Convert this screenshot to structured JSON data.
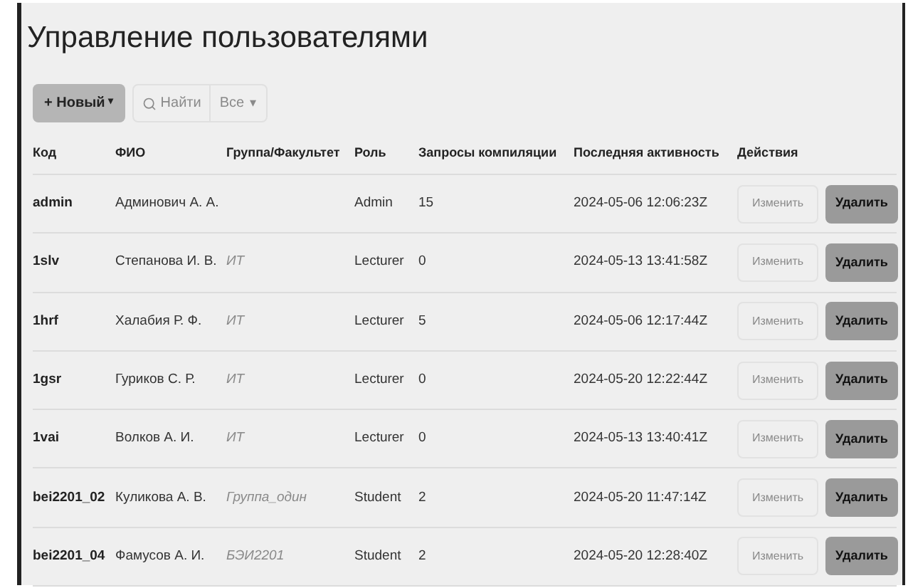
{
  "title": "Управление пользователями",
  "toolbar": {
    "new_button": "+ Новый",
    "new_caret": "▾",
    "search": {
      "label": "Найти",
      "disabled": true
    },
    "filter": {
      "value": "Все",
      "caret": "▾",
      "disabled": true
    }
  },
  "table": {
    "columns": [
      "Код",
      "ФИО",
      "Группа/Факультет",
      "Роль",
      "Запросы компиляции",
      "Последняя активность",
      "Действия"
    ],
    "rows": [
      {
        "code": "admin",
        "name": "Админович А. А.",
        "group": "",
        "role": "Admin",
        "requests": "15",
        "last": "2024-05-06 12:06:23Z",
        "edit": {
          "label": "Изменить",
          "disabled": true
        },
        "delete": "Удалить"
      },
      {
        "code": "1slv",
        "name": "Степанова И. В.",
        "group": "ИТ",
        "role": "Lecturer",
        "requests": "0",
        "last": "2024-05-13 13:41:58Z",
        "edit": {
          "label": "Изменить",
          "disabled": true
        },
        "delete": "Удалить"
      },
      {
        "code": "1hrf",
        "name": "Халабия Р. Ф.",
        "group": "ИТ",
        "role": "Lecturer",
        "requests": "5",
        "last": "2024-05-06 12:17:44Z",
        "edit": {
          "label": "Изменить",
          "disabled": true
        },
        "delete": "Удалить"
      },
      {
        "code": "1gsr",
        "name": "Гуриков С. Р.",
        "group": "ИТ",
        "role": "Lecturer",
        "requests": "0",
        "last": "2024-05-20 12:22:44Z",
        "edit": {
          "label": "Изменить",
          "disabled": true
        },
        "delete": "Удалить"
      },
      {
        "code": "1vai",
        "name": "Волков А. И.",
        "group": "ИТ",
        "role": "Lecturer",
        "requests": "0",
        "last": "2024-05-13 13:40:41Z",
        "edit": {
          "label": "Изменить",
          "disabled": true
        },
        "delete": "Удалить"
      },
      {
        "code": "bei2201_02",
        "name": "Куликова А. В.",
        "group": "Группа_один",
        "role": "Student",
        "requests": "2",
        "last": "2024-05-20 11:47:14Z",
        "edit": {
          "label": "Изменить",
          "disabled": true
        },
        "delete": "Удалить"
      },
      {
        "code": "bei2201_04",
        "name": "Фамусов А. И.",
        "group": "БЭИ2201",
        "role": "Student",
        "requests": "2",
        "last": "2024-05-20 12:28:40Z",
        "edit": {
          "label": "Изменить",
          "disabled": true
        },
        "delete": "Удалить"
      }
    ]
  }
}
